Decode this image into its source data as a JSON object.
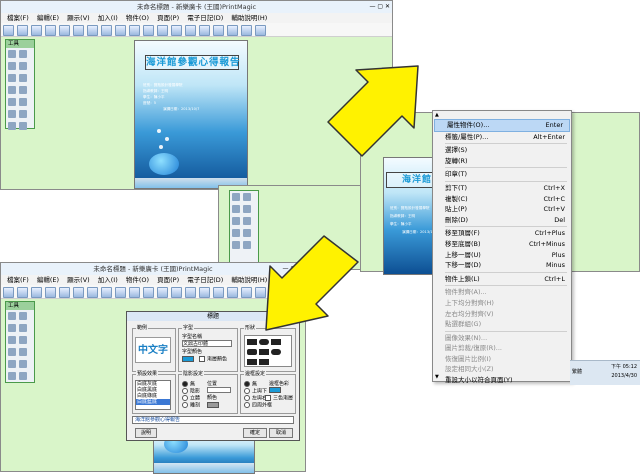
{
  "window1": {
    "title": "未命名標題 - 新樂廣卡 (王國)PrintMagic",
    "menu": [
      "檔案(F)",
      "編輯(E)",
      "顯示(V)",
      "加入(I)",
      "物件(O)",
      "頁面(P)",
      "電子日記(D)",
      "輔助說明(H)"
    ],
    "tool_panel_title": "工具",
    "poster_title": "海洋館參觀心得報告",
    "poster_lines": [
      "班別：寶瓶設計發展學院",
      "指導教師：王明",
      "學生：陳小平",
      "座號：5",
      "演講日期：2013/10/7"
    ]
  },
  "window2": {
    "poster_title": "海洋館參",
    "poster_lines": [
      "班別：寶瓶設計發展學院",
      "指導教師：王明",
      "學生：陳小平",
      "演講日期：2013/10/7"
    ]
  },
  "window3": {
    "title": "未命名標題 - 新樂廣卡 (王國)PrintMagic",
    "menu": [
      "檔案(F)",
      "編輯(E)",
      "顯示(V)",
      "加入(I)",
      "物件(O)",
      "頁面(P)",
      "電子日記(D)",
      "輔助說明(H)"
    ],
    "tool_panel_title": "工具"
  },
  "context_menu": {
    "items": [
      {
        "label": "屬性物件(O)...",
        "shortcut": "Enter",
        "state": "selected"
      },
      {
        "label": "標籤/屬性(P)...",
        "shortcut": "Alt+Enter",
        "state": "normal"
      },
      {
        "sep": true
      },
      {
        "label": "選擇(S)",
        "shortcut": "",
        "state": "normal"
      },
      {
        "label": "旋轉(R)",
        "shortcut": "",
        "state": "normal"
      },
      {
        "sep": true
      },
      {
        "label": "印章(T)",
        "shortcut": "",
        "state": "normal"
      },
      {
        "sep": true
      },
      {
        "label": "剪下(T)",
        "shortcut": "Ctrl+X",
        "state": "normal"
      },
      {
        "label": "複製(C)",
        "shortcut": "Ctrl+C",
        "state": "normal"
      },
      {
        "label": "貼上(P)",
        "shortcut": "Ctrl+V",
        "state": "normal"
      },
      {
        "label": "刪除(D)",
        "shortcut": "Del",
        "state": "normal"
      },
      {
        "sep": true
      },
      {
        "label": "移至頂層(F)",
        "shortcut": "Ctrl+Plus",
        "state": "normal"
      },
      {
        "label": "移至底層(B)",
        "shortcut": "Ctrl+Minus",
        "state": "normal"
      },
      {
        "label": "上移一層(U)",
        "shortcut": "Plus",
        "state": "normal"
      },
      {
        "label": "下移一層(D)",
        "shortcut": "Minus",
        "state": "normal"
      },
      {
        "sep": true
      },
      {
        "label": "物件上鎖(L)",
        "shortcut": "Ctrl+L",
        "state": "normal"
      },
      {
        "sep": true
      },
      {
        "label": "物件對齊(A)...",
        "shortcut": "",
        "state": "disabled"
      },
      {
        "label": "上下均分對齊(H)",
        "shortcut": "",
        "state": "disabled"
      },
      {
        "label": "左右均分對齊(V)",
        "shortcut": "",
        "state": "disabled"
      },
      {
        "label": "點選群組(G)",
        "shortcut": "",
        "state": "disabled"
      },
      {
        "sep": true
      },
      {
        "label": "圖像效果(N)...",
        "shortcut": "",
        "state": "disabled"
      },
      {
        "label": "圖片剪裁/復原(R)...",
        "shortcut": "",
        "state": "disabled"
      },
      {
        "label": "恢復圖片比例(I)",
        "shortcut": "",
        "state": "disabled"
      },
      {
        "label": "設定相同大小(Z)",
        "shortcut": "",
        "state": "disabled"
      },
      {
        "label": "重設大小以符合頁面(Y)",
        "shortcut": "",
        "state": "normal"
      }
    ]
  },
  "dialog": {
    "title": "標題",
    "close": "×",
    "sample_group": "範例",
    "sample_text": "中文字",
    "font_group": "字型",
    "font_name_label": "字型名稱",
    "font_name_value": "文鼎古印體",
    "font_color_label": "字型顏色",
    "gradient_color": "漸層顏色",
    "shape_group": "形狀",
    "preset_group": "預設效果",
    "preset_items": [
      "白底灰底",
      "白底黑底",
      "白底綠底",
      "白底藍底"
    ],
    "shadow_group": "陰影設定",
    "shadow_options": [
      "無",
      "陰影",
      "立體",
      "雕刻"
    ],
    "position_label": "位置",
    "color_label": "顏色",
    "border_group": "邊框設定",
    "border_options": [
      "無",
      "上與下",
      "左與右",
      "四周外框"
    ],
    "border_color_label": "邊框色彩",
    "three_color_gradient": "三色漸層",
    "input_value": "海洋館參觀心得報告",
    "help_button": "說明",
    "ok_button": "確定",
    "cancel_button": "取消"
  },
  "taskbar": {
    "time": "下午 05:12",
    "date": "2013/4/30",
    "ime": "繁體"
  }
}
